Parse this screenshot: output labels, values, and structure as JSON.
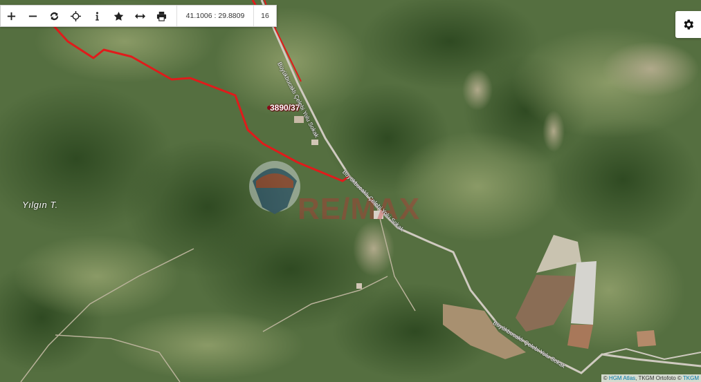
{
  "toolbar": {
    "buttons": [
      {
        "name": "zoom-in-button",
        "icon": "plus-icon"
      },
      {
        "name": "zoom-out-button",
        "icon": "minus-icon"
      },
      {
        "name": "refresh-button",
        "icon": "refresh-icon"
      },
      {
        "name": "locate-button",
        "icon": "crosshair-icon"
      },
      {
        "name": "info-button",
        "icon": "info-icon"
      },
      {
        "name": "favorite-button",
        "icon": "star-icon"
      },
      {
        "name": "measure-button",
        "icon": "arrows-horizontal-icon"
      },
      {
        "name": "print-button",
        "icon": "printer-icon"
      }
    ],
    "coordinates": "41.1006 : 29.8809",
    "zoom_level": "16"
  },
  "settings": {
    "icon": "gear-icon"
  },
  "map": {
    "parcel_label": "3890/37",
    "place_label": "Yılgın T.",
    "road_labels": [
      "Büyükbucaklı Çelebi Yolu Sokak",
      "Büyükbucaklı Çelebi Yolu Sokak",
      "Büyükbucaklı Çelebi Yolu Sokak"
    ],
    "watermark_logo": "RE/MAX",
    "watermark_text": "RE/MAX",
    "parcel_color": "#e01b1b"
  },
  "attribution": {
    "prefix": "©",
    "atlas": "HGM Atlas",
    "ortho_text": ", TKGM Ortofoto ©",
    "tkgm": "TKGM"
  }
}
